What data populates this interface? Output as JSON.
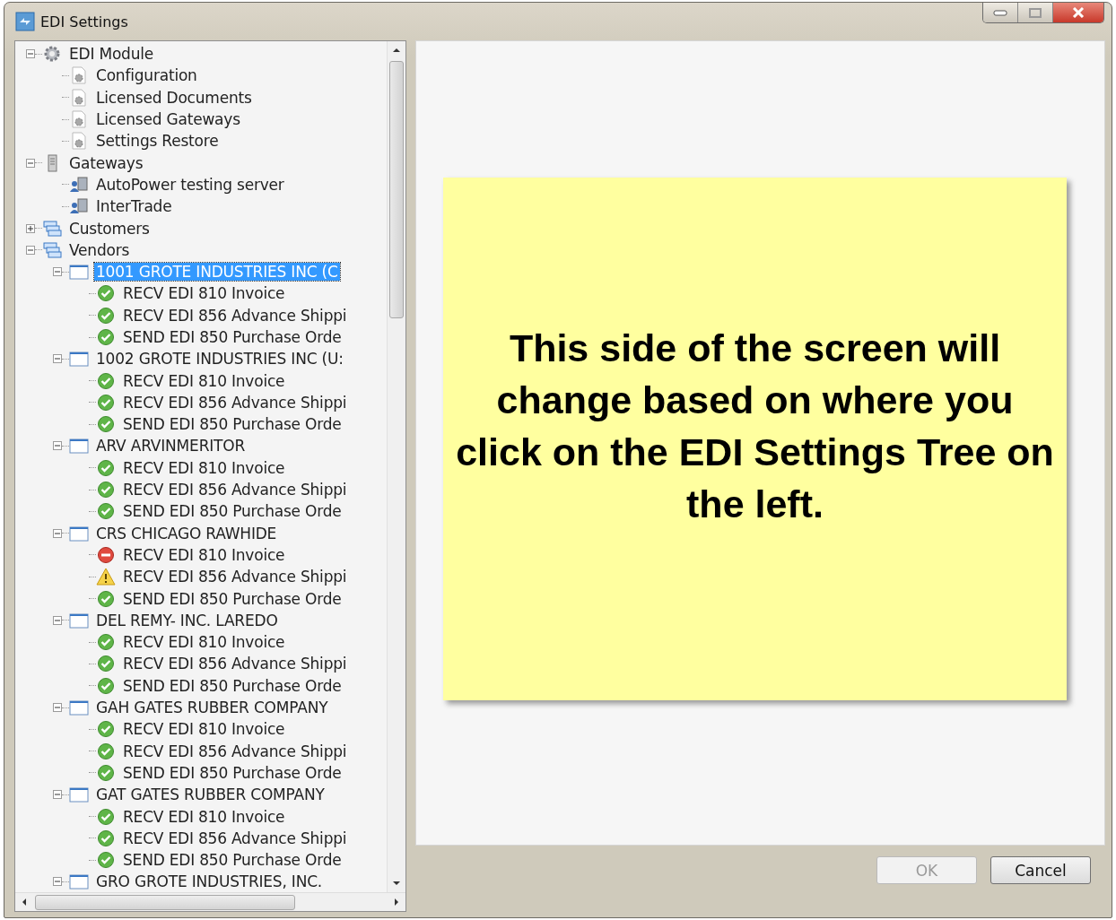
{
  "window": {
    "title": "EDI Settings"
  },
  "tree": [
    {
      "label": "EDI Module",
      "kind": "gear",
      "expanded": true,
      "selected": false,
      "children": [
        {
          "label": "Configuration",
          "kind": "gear-doc",
          "selected": false
        },
        {
          "label": "Licensed Documents",
          "kind": "gear-doc",
          "selected": false
        },
        {
          "label": "Licensed Gateways",
          "kind": "gear-doc",
          "selected": false
        },
        {
          "label": "Settings Restore",
          "kind": "gear-doc",
          "selected": false
        }
      ]
    },
    {
      "label": "Gateways",
      "kind": "server",
      "expanded": true,
      "selected": false,
      "children": [
        {
          "label": "AutoPower testing server",
          "kind": "gateway",
          "selected": false
        },
        {
          "label": "InterTrade",
          "kind": "gateway",
          "selected": false
        }
      ]
    },
    {
      "label": "Customers",
      "kind": "group",
      "expanded": false,
      "selected": false
    },
    {
      "label": "Vendors",
      "kind": "group",
      "expanded": true,
      "selected": false,
      "children": [
        {
          "label": "1001 GROTE INDUSTRIES INC (C",
          "kind": "vendor",
          "expanded": true,
          "selected": true,
          "children": [
            {
              "label": "RECV EDI 810 Invoice",
              "kind": "ok",
              "selected": false
            },
            {
              "label": "RECV EDI 856 Advance Shippi",
              "kind": "ok",
              "selected": false
            },
            {
              "label": "SEND EDI 850 Purchase Orde",
              "kind": "ok",
              "selected": false
            }
          ]
        },
        {
          "label": "1002 GROTE INDUSTRIES INC (U:",
          "kind": "vendor",
          "expanded": true,
          "selected": false,
          "children": [
            {
              "label": "RECV EDI 810 Invoice",
              "kind": "ok",
              "selected": false
            },
            {
              "label": "RECV EDI 856 Advance Shippi",
              "kind": "ok",
              "selected": false
            },
            {
              "label": "SEND EDI 850 Purchase Orde",
              "kind": "ok",
              "selected": false
            }
          ]
        },
        {
          "label": "ARV ARVINMERITOR",
          "kind": "vendor",
          "expanded": true,
          "selected": false,
          "children": [
            {
              "label": "RECV EDI 810 Invoice",
              "kind": "ok",
              "selected": false
            },
            {
              "label": "RECV EDI 856 Advance Shippi",
              "kind": "ok",
              "selected": false
            },
            {
              "label": "SEND EDI 850 Purchase Orde",
              "kind": "ok",
              "selected": false
            }
          ]
        },
        {
          "label": "CRS CHICAGO RAWHIDE",
          "kind": "vendor",
          "expanded": true,
          "selected": false,
          "children": [
            {
              "label": "RECV EDI 810 Invoice",
              "kind": "error",
              "selected": false
            },
            {
              "label": "RECV EDI 856 Advance Shippi",
              "kind": "warning",
              "selected": false
            },
            {
              "label": "SEND EDI 850 Purchase Orde",
              "kind": "ok",
              "selected": false
            }
          ]
        },
        {
          "label": "DEL REMY- INC. LAREDO",
          "kind": "vendor",
          "expanded": true,
          "selected": false,
          "children": [
            {
              "label": "RECV EDI 810 Invoice",
              "kind": "ok",
              "selected": false
            },
            {
              "label": "RECV EDI 856 Advance Shippi",
              "kind": "ok",
              "selected": false
            },
            {
              "label": "SEND EDI 850 Purchase Orde",
              "kind": "ok",
              "selected": false
            }
          ]
        },
        {
          "label": "GAH GATES RUBBER COMPANY",
          "kind": "vendor",
          "expanded": true,
          "selected": false,
          "children": [
            {
              "label": "RECV EDI 810 Invoice",
              "kind": "ok",
              "selected": false
            },
            {
              "label": "RECV EDI 856 Advance Shippi",
              "kind": "ok",
              "selected": false
            },
            {
              "label": "SEND EDI 850 Purchase Orde",
              "kind": "ok",
              "selected": false
            }
          ]
        },
        {
          "label": "GAT GATES RUBBER COMPANY",
          "kind": "vendor",
          "expanded": true,
          "selected": false,
          "children": [
            {
              "label": "RECV EDI 810 Invoice",
              "kind": "ok",
              "selected": false
            },
            {
              "label": "RECV EDI 856 Advance Shippi",
              "kind": "ok",
              "selected": false
            },
            {
              "label": "SEND EDI 850 Purchase Orde",
              "kind": "ok",
              "selected": false
            }
          ]
        },
        {
          "label": "GRO GROTE INDUSTRIES, INC.",
          "kind": "vendor",
          "expanded": true,
          "selected": false
        }
      ]
    }
  ],
  "note": {
    "text": "This side of the screen will change based on where you click on the EDI Settings Tree on the left."
  },
  "buttons": [
    {
      "label": "OK",
      "disabled": true
    },
    {
      "label": "Cancel",
      "disabled": false
    }
  ]
}
